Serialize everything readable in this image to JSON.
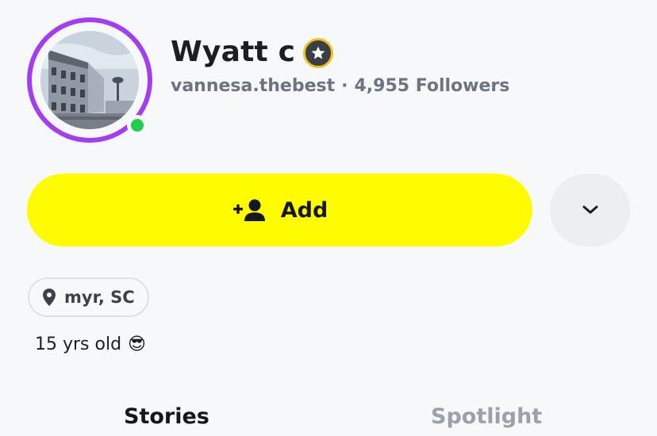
{
  "profile": {
    "display_name": "Wyatt c",
    "username": "vannesa.thebest",
    "separator": "·",
    "followers": "4,955 Followers",
    "online": true
  },
  "actions": {
    "add_label": "Add",
    "add_icon": "add-friend-icon",
    "more_icon": "chevron-down-icon"
  },
  "details": {
    "location": "myr, SC",
    "location_icon": "location-pin-icon",
    "bio": "15 yrs old",
    "bio_emoji": "😎"
  },
  "tabs": [
    {
      "label": "Stories",
      "active": true
    },
    {
      "label": "Spotlight",
      "active": false
    }
  ],
  "colors": {
    "ring": "#a33df0",
    "online": "#1fce4c",
    "add_button": "#fffc00",
    "badge_ring": "#f0c020"
  }
}
